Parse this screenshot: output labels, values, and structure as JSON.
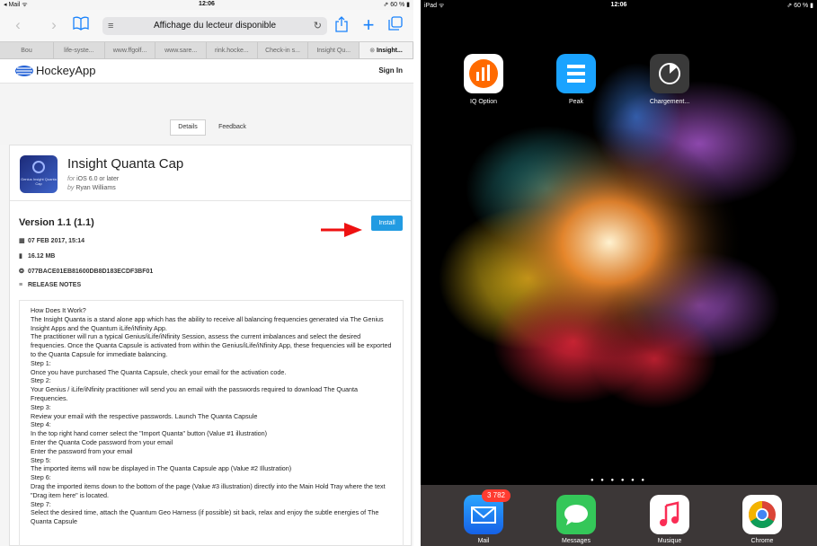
{
  "left": {
    "status": {
      "carrier": "Mail",
      "time": "12:06",
      "battery": "60 %"
    },
    "toolbar": {
      "title": "Affichage du lecteur disponible"
    },
    "tabs": [
      "Bou",
      "life-syste...",
      "www.ffgolf...",
      "www.sare...",
      "rink.hocke...",
      "Check-in s...",
      "Insight Qu...",
      "Insight..."
    ],
    "brand": {
      "name": "HockeyApp",
      "signin": "Sign In"
    },
    "segments": {
      "details": "Details",
      "feedback": "Feedback"
    },
    "app": {
      "title": "Insight Quanta Cap",
      "platform_prefix": "for",
      "platform": "iOS 6.0 or later",
      "author_prefix": "by",
      "author": "Ryan Williams",
      "icon_text": "Genius Insight Quanta Cap"
    },
    "version": "Version 1.1 (1.1)",
    "install_label": "Install",
    "meta": {
      "date": "07 FEB 2017, 15:14",
      "size": "16.12 MB",
      "hash": "077BACE01EB81600DB8D183ECDF3BF01",
      "notes_heading": "RELEASE NOTES"
    },
    "notes": [
      "How Does It Work?",
      "The Insight Quanta is a stand alone app which has the ability to receive all balancing frequencies generated via The Genius Insight Apps and the Quantum iLife/iNfinity App.",
      "The practitioner will run a typical Genius/iLife/iNfinity Session, assess the current imbalances and select the desired frequencies. Once the Quanta Capsule is activated from within the Genius/iLife/iNfinity App, these frequencies will be exported to the Quanta Capsule for immediate balancing.",
      "Step 1:",
      "Once you have purchased The Quanta Capsule, check your email for the activation code.",
      "Step 2:",
      "Your Genius / iLife/iNfinity practitioner will send you an email with the passwords required to download The Quanta Frequencies.",
      "Step 3:",
      "Review your email with the respective passwords. Launch The Quanta Capsule",
      "Step 4:",
      "In the top right hand corner select the \"Import Quanta\" button (Value #1 illustration)",
      "Enter the Quanta Code password from your email",
      "Enter the password from your email",
      "Step 5:",
      "The imported items will now be displayed in The Quanta Capsule app (Value #2 Illustration)",
      "Step 6:",
      "Drag the imported items down to the bottom of the page (Value #3 illustration) directly into the Main Hold Tray where the text \"Drag item here\" is located.",
      "Step 7:",
      "Select the desired time, attach the Quantum Geo Harness (if possible) sit back, relax and enjoy the subtle energies of The Quanta Capsule"
    ]
  },
  "right": {
    "status": {
      "device": "iPad",
      "time": "12:06",
      "battery": "60 %"
    },
    "apps": [
      {
        "label": "IQ Option",
        "color": "#ff6a00"
      },
      {
        "label": "Peak",
        "color": "#1aa3ff"
      },
      {
        "label": "Chargement...",
        "color": "#3a3a3a"
      }
    ],
    "dock": [
      {
        "label": "Mail",
        "badge": "3 782"
      },
      {
        "label": "Messages"
      },
      {
        "label": "Musique"
      },
      {
        "label": "Chrome"
      }
    ],
    "colors": {
      "accent": "#229be2",
      "arrow": "#ee1111"
    }
  }
}
